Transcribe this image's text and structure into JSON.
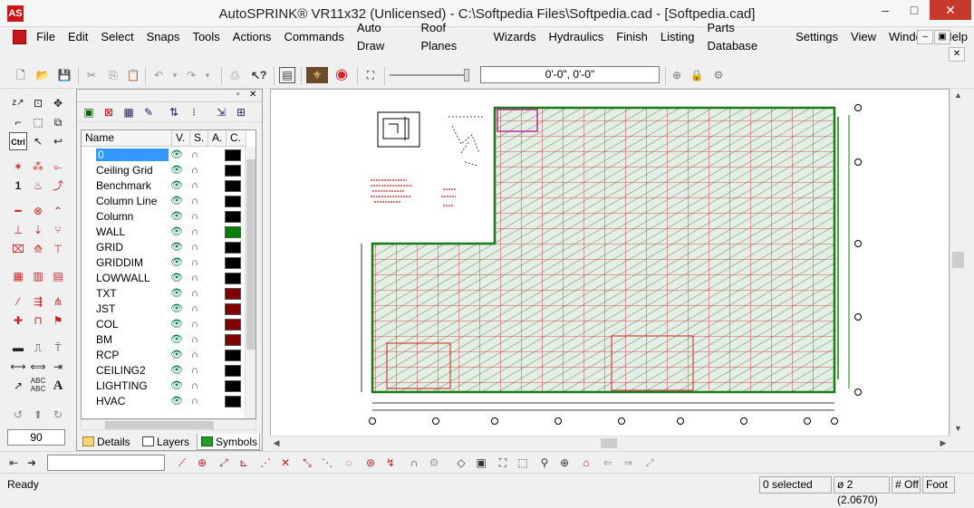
{
  "window": {
    "title": "AutoSPRINK® VR11x32 (Unlicensed) - C:\\Softpedia Files\\Softpedia.cad - [Softpedia.cad]",
    "app_icon": "autosprink-logo",
    "controls": {
      "minimize": "–",
      "maximize": "□",
      "close": "✕"
    }
  },
  "menu": {
    "items": [
      "File",
      "Edit",
      "Select",
      "Snaps",
      "Tools",
      "Actions",
      "Commands",
      "Auto Draw",
      "Roof Planes",
      "Wizards",
      "Hydraulics",
      "Finish",
      "Listing",
      "Parts Database",
      "Settings",
      "View",
      "Window",
      "Help"
    ],
    "mdi_controls": {
      "minimize": "–",
      "restore": "▣",
      "close": "✕"
    }
  },
  "toolbar": {
    "icons": [
      "new-file-icon",
      "open-folder-icon",
      "save-icon",
      "cut-icon",
      "copy-icon",
      "paste-icon",
      "undo-icon",
      "redo-icon",
      "print-icon",
      "help-pointer-icon",
      "properties-icon",
      "render-icon",
      "target-icon",
      "zoom-extents-icon",
      "zoom-slider",
      "snap-icon",
      "lock-icon",
      "settings-gear-icon"
    ],
    "coordinates": "0'-0\", 0'-0\""
  },
  "palette": {
    "angle_value": "90",
    "ctrl_label": "Ctrl"
  },
  "layers": {
    "columns": [
      "Name",
      "V.",
      "S.",
      "A.",
      "C."
    ],
    "rows": [
      {
        "name": "0",
        "color": "#000000",
        "selected": true
      },
      {
        "name": "Ceiling Grid",
        "color": "#000000"
      },
      {
        "name": "Benchmark",
        "color": "#000000"
      },
      {
        "name": "Column Line",
        "color": "#000000"
      },
      {
        "name": "Column",
        "color": "#000000"
      },
      {
        "name": "WALL",
        "color": "#008000"
      },
      {
        "name": "GRID",
        "color": "#000000"
      },
      {
        "name": "GRIDDIM",
        "color": "#000000"
      },
      {
        "name": "LOWWALL",
        "color": "#000000"
      },
      {
        "name": "TXT",
        "color": "#800000"
      },
      {
        "name": "JST",
        "color": "#800000"
      },
      {
        "name": "COL",
        "color": "#800000"
      },
      {
        "name": "BM",
        "color": "#800000"
      },
      {
        "name": "RCP",
        "color": "#000000"
      },
      {
        "name": "CEILING2",
        "color": "#000000"
      },
      {
        "name": "LIGHTING",
        "color": "#000000"
      },
      {
        "name": "HVAC",
        "color": "#000000"
      }
    ],
    "tabs": [
      "Details",
      "Layers",
      "Symbols"
    ],
    "active_tab": "Symbols"
  },
  "drawing": {
    "colors": {
      "wall": "#1a7a1a",
      "grid": "#d21e1e",
      "hatch": "#5a8a6a",
      "fill": "#e4eee4"
    }
  },
  "status": {
    "ready": "Ready",
    "selected": "0 selected",
    "diameter": "ø 2 (2.0670)",
    "snap": "# Off",
    "units": "Foot"
  }
}
